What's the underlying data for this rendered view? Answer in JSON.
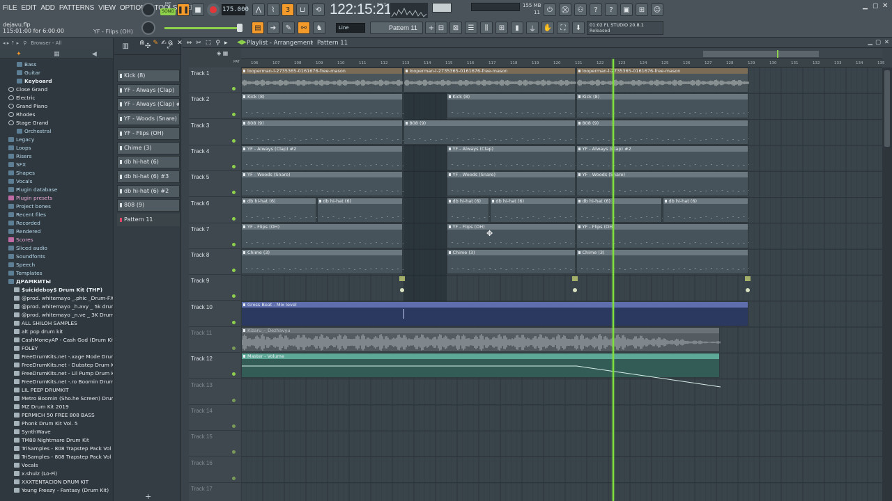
{
  "menu": [
    "FILE",
    "EDIT",
    "ADD",
    "PATTERNS",
    "VIEW",
    "OPTIONS",
    "TOOLS",
    "HELP"
  ],
  "transport": {
    "song_label": "SONG",
    "pat_label": "PAT",
    "tempo": "175.000",
    "time": "122:15:21",
    "time_sub": "B:S:T",
    "cpu_ram": "155 MB",
    "cpu_value": "11",
    "voices": "4"
  },
  "file": {
    "name": "dejavu.flp",
    "position": "115:01:00 for 6:00:00",
    "hint": "YF - Flips (OH)"
  },
  "pattern_selector": {
    "snap": "Line",
    "current": "Pattern 11"
  },
  "news": {
    "line1": "01:02  FL STUDIO 20.8.1",
    "line2": "Released"
  },
  "browser": {
    "header": "Browser - All",
    "items": [
      {
        "label": "Bass",
        "style": "sub"
      },
      {
        "label": "Guitar",
        "style": "sub"
      },
      {
        "label": "Keyboard",
        "style": "sub-bold"
      },
      {
        "label": "Close Grand",
        "style": "gear"
      },
      {
        "label": "Electric",
        "style": "gear"
      },
      {
        "label": "Grand Piano",
        "style": "gear"
      },
      {
        "label": "Rhodes",
        "style": "gear"
      },
      {
        "label": "Stage Grand",
        "style": "gear"
      },
      {
        "label": "Orchestral",
        "style": "sub"
      },
      {
        "label": "Legacy",
        "style": "folder"
      },
      {
        "label": "Loops",
        "style": "folder"
      },
      {
        "label": "Risers",
        "style": "folder"
      },
      {
        "label": "SFX",
        "style": "folder"
      },
      {
        "label": "Shapes",
        "style": "folder"
      },
      {
        "label": "Vocals",
        "style": "folder"
      },
      {
        "label": "Plugin database",
        "style": "folder"
      },
      {
        "label": "Plugin presets",
        "style": "pink"
      },
      {
        "label": "Project bones",
        "style": "folder"
      },
      {
        "label": "Recent files",
        "style": "folder"
      },
      {
        "label": "Recorded",
        "style": "folder"
      },
      {
        "label": "Rendered",
        "style": "folder"
      },
      {
        "label": "Scores",
        "style": "pink"
      },
      {
        "label": "Sliced audio",
        "style": "folder"
      },
      {
        "label": "Soundfonts",
        "style": "folder"
      },
      {
        "label": "Speech",
        "style": "folder"
      },
      {
        "label": "Templates",
        "style": "folder"
      },
      {
        "label": "ДРАМКИТЫ",
        "style": "folder-bold"
      },
      {
        "label": "$uicideboy$ Drum Kit (THP)",
        "style": "white-bold"
      },
      {
        "label": "@prod. whitemayo _.phic _Drum-FX Kit",
        "style": "white"
      },
      {
        "label": "@prod. whitemayo _h.avy _ 5k drum kit",
        "style": "white"
      },
      {
        "label": "@prod. whitemayo _n.ve _ 3K Drum Kit",
        "style": "white"
      },
      {
        "label": "ALL SHILOH SAMPLES",
        "style": "white"
      },
      {
        "label": "alt pop drum kit",
        "style": "white"
      },
      {
        "label": "CashMoneyAP - Cash God (Drum Kit)",
        "style": "white"
      },
      {
        "label": "FOLEY",
        "style": "white"
      },
      {
        "label": "FreeDrumKits.net -.xage Mode Drum Kit",
        "style": "white"
      },
      {
        "label": "FreeDrumKits.net - Dubstep Drum Kit",
        "style": "white"
      },
      {
        "label": "FreeDrumKits.net - Lil Pump Drum Kit",
        "style": "white"
      },
      {
        "label": "FreeDrumKits.net -.ro Boomin Drum Kit",
        "style": "white"
      },
      {
        "label": "LIL PEEP DRUMKIT",
        "style": "white"
      },
      {
        "label": "Metro Boomin (Sho.he Screen) Drumkit",
        "style": "white"
      },
      {
        "label": "MZ Drum Kit 2019",
        "style": "white"
      },
      {
        "label": "PERMICH 50 FREE 808 BASS",
        "style": "white"
      },
      {
        "label": "Phonk Drum Kit Vol. 5",
        "style": "white"
      },
      {
        "label": "SynthWave",
        "style": "white"
      },
      {
        "label": "TM88 Nightmare Drum Kit",
        "style": "white"
      },
      {
        "label": "TriSamples - 808 Trapstep Pack Vol 1",
        "style": "white"
      },
      {
        "label": "TriSamples - 808 Trapstep Pack Vol 2",
        "style": "white"
      },
      {
        "label": "Vocals",
        "style": "white"
      },
      {
        "label": "x.shulz (Lo-Fi)",
        "style": "white"
      },
      {
        "label": "XXXTENTACION DRUM KIT",
        "style": "white"
      },
      {
        "label": "Young Freezy - Fantasy (Drum Kit)",
        "style": "white"
      }
    ]
  },
  "patterns": [
    {
      "label": "Kick (8)"
    },
    {
      "label": "YF - Always (Clap)"
    },
    {
      "label": "YF - Always (Clap) #2"
    },
    {
      "label": "YF - Woods (Snare)"
    },
    {
      "label": "YF - Flips (OH)"
    },
    {
      "label": "Chime (3)"
    },
    {
      "label": "db hi-hat (6)"
    },
    {
      "label": "db hi-hat (6) #3"
    },
    {
      "label": "db hi-hat (6) #2"
    },
    {
      "label": "808 (9)"
    },
    {
      "label": "Pattern 11",
      "selected": true
    }
  ],
  "playlist": {
    "title": "Playlist - Arrangement",
    "pattern": "Pattern 11",
    "ruler": [
      "106",
      "107",
      "108",
      "109",
      "110",
      "111",
      "112",
      "113",
      "114",
      "115",
      "116",
      "117",
      "118",
      "119",
      "120",
      "121",
      "122",
      "123",
      "124",
      "125",
      "126",
      "127",
      "128",
      "129",
      "130",
      "131",
      "132",
      "133",
      "134",
      "135"
    ],
    "tracks": [
      {
        "name": "Track 1",
        "active": true
      },
      {
        "name": "Track 2",
        "active": true
      },
      {
        "name": "Track 3",
        "active": true
      },
      {
        "name": "Track 4",
        "active": true
      },
      {
        "name": "Track 5",
        "active": true
      },
      {
        "name": "Track 6",
        "active": true
      },
      {
        "name": "Track 7",
        "active": true
      },
      {
        "name": "Track 8",
        "active": true
      },
      {
        "name": "Track 9",
        "active": true
      },
      {
        "name": "Track 10",
        "active": true
      },
      {
        "name": "Track 11",
        "active": false
      },
      {
        "name": "Track 12",
        "active": true
      },
      {
        "name": "Track 13",
        "active": false
      },
      {
        "name": "Track 14",
        "active": false
      },
      {
        "name": "Track 15",
        "active": false
      },
      {
        "name": "Track 16",
        "active": false
      },
      {
        "name": "Track 17",
        "active": false
      }
    ],
    "clips": [
      {
        "track": 0,
        "start": 106,
        "len": 7.5,
        "label": "looperman-l-2735365-0161676-free-mason",
        "kind": "audio"
      },
      {
        "track": 0,
        "start": 113.5,
        "len": 8,
        "label": "looperman-l-2735365-0161676-free-mason",
        "kind": "audio"
      },
      {
        "track": 0,
        "start": 121.5,
        "len": 8,
        "label": "looperman-l-2735365-0161676-free-mason",
        "kind": "audio"
      },
      {
        "track": 1,
        "start": 106,
        "len": 7.5,
        "label": "Kick (8)"
      },
      {
        "track": 1,
        "start": 115.5,
        "len": 6,
        "label": "Kick (8)"
      },
      {
        "track": 1,
        "start": 121.5,
        "len": 8,
        "label": "Kick (8)"
      },
      {
        "track": 2,
        "start": 106,
        "len": 7.5,
        "label": "808 (9)"
      },
      {
        "track": 2,
        "start": 113.5,
        "len": 8,
        "label": "808 (9)"
      },
      {
        "track": 2,
        "start": 121.5,
        "len": 8,
        "label": "808 (9)"
      },
      {
        "track": 3,
        "start": 106,
        "len": 7.5,
        "label": "YF - Always (Clap) #2"
      },
      {
        "track": 3,
        "start": 115.5,
        "len": 6,
        "label": "YF - Always (Clap)"
      },
      {
        "track": 3,
        "start": 121.5,
        "len": 8,
        "label": "YF - Always (Clap) #2"
      },
      {
        "track": 4,
        "start": 106,
        "len": 7.5,
        "label": "YF - Woods (Snare)"
      },
      {
        "track": 4,
        "start": 115.5,
        "len": 6,
        "label": "YF - Woods (Snare)"
      },
      {
        "track": 4,
        "start": 121.5,
        "len": 8,
        "label": "YF - Woods (Snare)"
      },
      {
        "track": 5,
        "start": 106,
        "len": 3.5,
        "label": "db hi-hat (6)"
      },
      {
        "track": 5,
        "start": 109.5,
        "len": 4,
        "label": "db hi-hat (6)"
      },
      {
        "track": 5,
        "start": 115.5,
        "len": 2,
        "label": "db hi-hat (6)"
      },
      {
        "track": 5,
        "start": 117.5,
        "len": 4,
        "label": "db hi-hat (6)"
      },
      {
        "track": 5,
        "start": 121.5,
        "len": 4,
        "label": "db hi-hat (6)"
      },
      {
        "track": 5,
        "start": 125.5,
        "len": 4,
        "label": "db hi-hat (6)"
      },
      {
        "track": 6,
        "start": 106,
        "len": 7.5,
        "label": "YF - Flips (OH)"
      },
      {
        "track": 6,
        "start": 115.5,
        "len": 6,
        "label": "YF - Flips (OH)"
      },
      {
        "track": 6,
        "start": 121.5,
        "len": 8,
        "label": "YF - Flips (OH)"
      },
      {
        "track": 7,
        "start": 106,
        "len": 7.5,
        "label": "Chime (3)"
      },
      {
        "track": 7,
        "start": 115.5,
        "len": 6,
        "label": "Chime (3)"
      },
      {
        "track": 7,
        "start": 121.5,
        "len": 8,
        "label": "Chime (3)"
      },
      {
        "track": 9,
        "start": 106,
        "len": 23.5,
        "label": "Gross Beat - Mix level",
        "kind": "auto-blue"
      },
      {
        "track": 10,
        "start": 106,
        "len": 22.2,
        "label": "Kizaru_-_Dezhavyu",
        "kind": "gray"
      },
      {
        "track": 11,
        "start": 106,
        "len": 22.2,
        "label": "Master - Volume",
        "kind": "auto-green"
      }
    ],
    "playhead_bar": 123.2
  },
  "colors": {
    "accent": "#f39a2a",
    "playhead": "#7fe03e",
    "active_led": "#8fd14d"
  }
}
